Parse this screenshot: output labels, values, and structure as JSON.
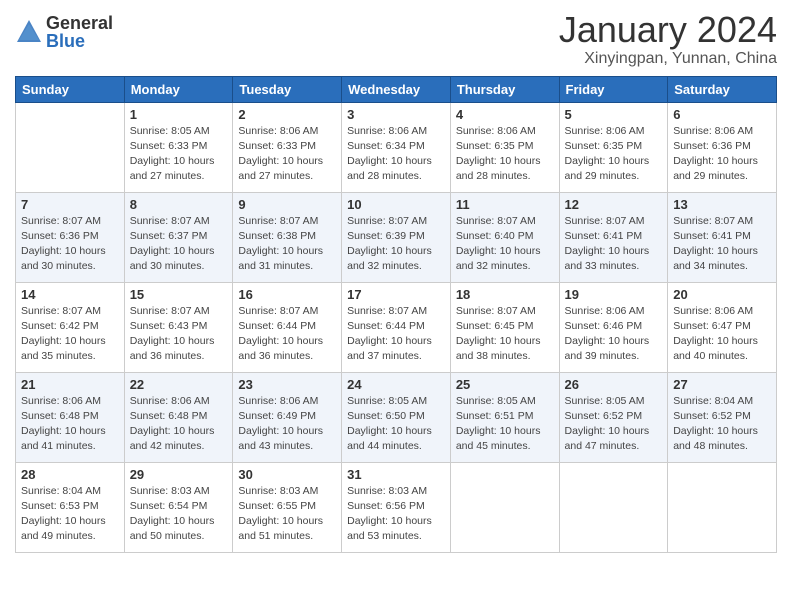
{
  "header": {
    "logo_general": "General",
    "logo_blue": "Blue",
    "month_title": "January 2024",
    "location": "Xinyingpan, Yunnan, China"
  },
  "days_of_week": [
    "Sunday",
    "Monday",
    "Tuesday",
    "Wednesday",
    "Thursday",
    "Friday",
    "Saturday"
  ],
  "weeks": [
    [
      {
        "day": "",
        "info": ""
      },
      {
        "day": "1",
        "info": "Sunrise: 8:05 AM\nSunset: 6:33 PM\nDaylight: 10 hours\nand 27 minutes."
      },
      {
        "day": "2",
        "info": "Sunrise: 8:06 AM\nSunset: 6:33 PM\nDaylight: 10 hours\nand 27 minutes."
      },
      {
        "day": "3",
        "info": "Sunrise: 8:06 AM\nSunset: 6:34 PM\nDaylight: 10 hours\nand 28 minutes."
      },
      {
        "day": "4",
        "info": "Sunrise: 8:06 AM\nSunset: 6:35 PM\nDaylight: 10 hours\nand 28 minutes."
      },
      {
        "day": "5",
        "info": "Sunrise: 8:06 AM\nSunset: 6:35 PM\nDaylight: 10 hours\nand 29 minutes."
      },
      {
        "day": "6",
        "info": "Sunrise: 8:06 AM\nSunset: 6:36 PM\nDaylight: 10 hours\nand 29 minutes."
      }
    ],
    [
      {
        "day": "7",
        "info": "Sunrise: 8:07 AM\nSunset: 6:36 PM\nDaylight: 10 hours\nand 30 minutes."
      },
      {
        "day": "8",
        "info": "Sunrise: 8:07 AM\nSunset: 6:37 PM\nDaylight: 10 hours\nand 30 minutes."
      },
      {
        "day": "9",
        "info": "Sunrise: 8:07 AM\nSunset: 6:38 PM\nDaylight: 10 hours\nand 31 minutes."
      },
      {
        "day": "10",
        "info": "Sunrise: 8:07 AM\nSunset: 6:39 PM\nDaylight: 10 hours\nand 32 minutes."
      },
      {
        "day": "11",
        "info": "Sunrise: 8:07 AM\nSunset: 6:40 PM\nDaylight: 10 hours\nand 32 minutes."
      },
      {
        "day": "12",
        "info": "Sunrise: 8:07 AM\nSunset: 6:41 PM\nDaylight: 10 hours\nand 33 minutes."
      },
      {
        "day": "13",
        "info": "Sunrise: 8:07 AM\nSunset: 6:41 PM\nDaylight: 10 hours\nand 34 minutes."
      }
    ],
    [
      {
        "day": "14",
        "info": "Sunrise: 8:07 AM\nSunset: 6:42 PM\nDaylight: 10 hours\nand 35 minutes."
      },
      {
        "day": "15",
        "info": "Sunrise: 8:07 AM\nSunset: 6:43 PM\nDaylight: 10 hours\nand 36 minutes."
      },
      {
        "day": "16",
        "info": "Sunrise: 8:07 AM\nSunset: 6:44 PM\nDaylight: 10 hours\nand 36 minutes."
      },
      {
        "day": "17",
        "info": "Sunrise: 8:07 AM\nSunset: 6:44 PM\nDaylight: 10 hours\nand 37 minutes."
      },
      {
        "day": "18",
        "info": "Sunrise: 8:07 AM\nSunset: 6:45 PM\nDaylight: 10 hours\nand 38 minutes."
      },
      {
        "day": "19",
        "info": "Sunrise: 8:06 AM\nSunset: 6:46 PM\nDaylight: 10 hours\nand 39 minutes."
      },
      {
        "day": "20",
        "info": "Sunrise: 8:06 AM\nSunset: 6:47 PM\nDaylight: 10 hours\nand 40 minutes."
      }
    ],
    [
      {
        "day": "21",
        "info": "Sunrise: 8:06 AM\nSunset: 6:48 PM\nDaylight: 10 hours\nand 41 minutes."
      },
      {
        "day": "22",
        "info": "Sunrise: 8:06 AM\nSunset: 6:48 PM\nDaylight: 10 hours\nand 42 minutes."
      },
      {
        "day": "23",
        "info": "Sunrise: 8:06 AM\nSunset: 6:49 PM\nDaylight: 10 hours\nand 43 minutes."
      },
      {
        "day": "24",
        "info": "Sunrise: 8:05 AM\nSunset: 6:50 PM\nDaylight: 10 hours\nand 44 minutes."
      },
      {
        "day": "25",
        "info": "Sunrise: 8:05 AM\nSunset: 6:51 PM\nDaylight: 10 hours\nand 45 minutes."
      },
      {
        "day": "26",
        "info": "Sunrise: 8:05 AM\nSunset: 6:52 PM\nDaylight: 10 hours\nand 47 minutes."
      },
      {
        "day": "27",
        "info": "Sunrise: 8:04 AM\nSunset: 6:52 PM\nDaylight: 10 hours\nand 48 minutes."
      }
    ],
    [
      {
        "day": "28",
        "info": "Sunrise: 8:04 AM\nSunset: 6:53 PM\nDaylight: 10 hours\nand 49 minutes."
      },
      {
        "day": "29",
        "info": "Sunrise: 8:03 AM\nSunset: 6:54 PM\nDaylight: 10 hours\nand 50 minutes."
      },
      {
        "day": "30",
        "info": "Sunrise: 8:03 AM\nSunset: 6:55 PM\nDaylight: 10 hours\nand 51 minutes."
      },
      {
        "day": "31",
        "info": "Sunrise: 8:03 AM\nSunset: 6:56 PM\nDaylight: 10 hours\nand 53 minutes."
      },
      {
        "day": "",
        "info": ""
      },
      {
        "day": "",
        "info": ""
      },
      {
        "day": "",
        "info": ""
      }
    ]
  ]
}
